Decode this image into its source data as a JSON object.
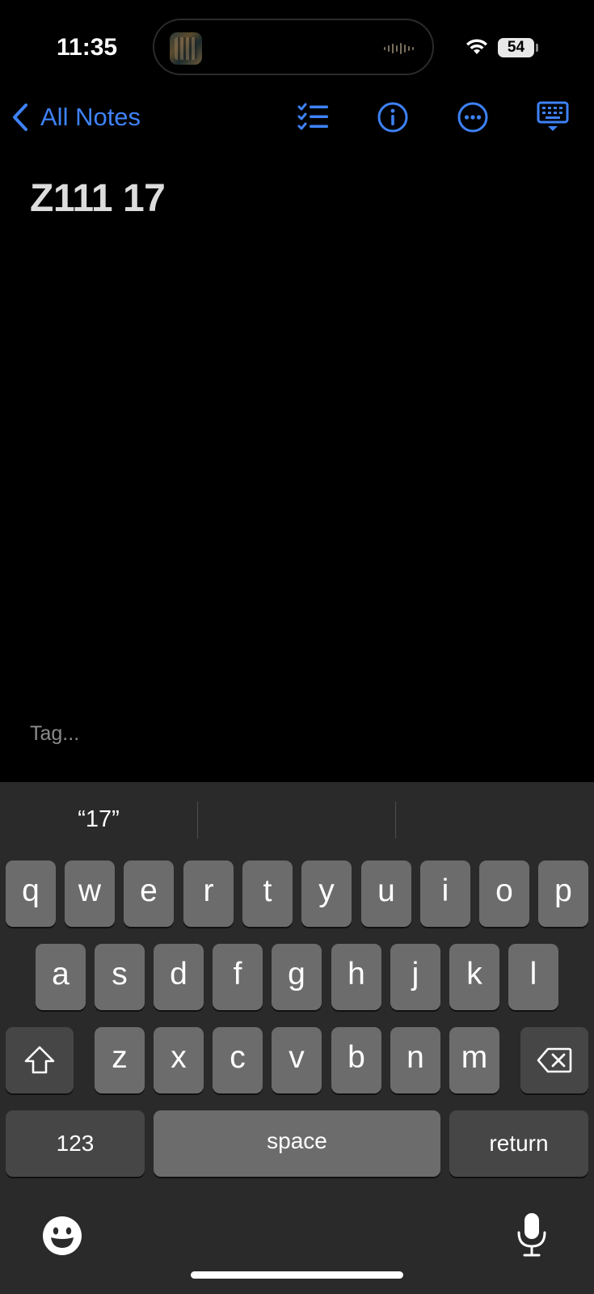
{
  "status_bar": {
    "time": "11:35",
    "battery": "54"
  },
  "nav": {
    "back_label": "All Notes",
    "icons": [
      "checklist-icon",
      "info-icon",
      "more-icon",
      "hide-keyboard-icon"
    ]
  },
  "note": {
    "title": "Z111 17",
    "tag_placeholder": "Tag..."
  },
  "keyboard": {
    "suggestions": [
      "“17”",
      "",
      ""
    ],
    "row1": [
      "q",
      "w",
      "e",
      "r",
      "t",
      "y",
      "u",
      "i",
      "o",
      "p"
    ],
    "row2": [
      "a",
      "s",
      "d",
      "f",
      "g",
      "h",
      "j",
      "k",
      "l"
    ],
    "row3": [
      "z",
      "x",
      "c",
      "v",
      "b",
      "n",
      "m"
    ],
    "numbers_label": "123",
    "space_label": "space",
    "return_label": "return"
  },
  "colors": {
    "accent": "#3e82f7",
    "key": "#6c6c6c",
    "key_dark": "#464646",
    "keyboard_bg": "#2a2a2a"
  }
}
